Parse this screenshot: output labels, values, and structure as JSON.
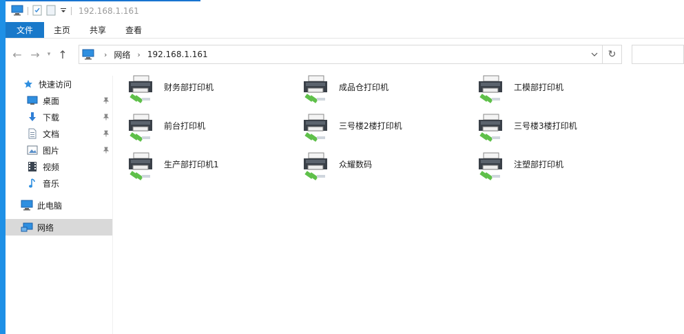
{
  "window": {
    "title": "192.168.1.161"
  },
  "ribbon": {
    "tabs": [
      {
        "label": "文件"
      },
      {
        "label": "主页"
      },
      {
        "label": "共享"
      },
      {
        "label": "查看"
      }
    ]
  },
  "address": {
    "crumbs": [
      "网络",
      "192.168.1.161"
    ]
  },
  "sidebar": {
    "quick_access": "快速访问",
    "items": [
      {
        "label": "桌面",
        "icon": "desktop-icon",
        "pinned": true
      },
      {
        "label": "下载",
        "icon": "download-icon",
        "pinned": true
      },
      {
        "label": "文档",
        "icon": "document-icon",
        "pinned": true
      },
      {
        "label": "图片",
        "icon": "picture-icon",
        "pinned": true
      },
      {
        "label": "视频",
        "icon": "video-icon",
        "pinned": false
      },
      {
        "label": "音乐",
        "icon": "music-icon",
        "pinned": false
      }
    ],
    "this_pc": "此电脑",
    "network": "网络"
  },
  "printers": [
    "财务部打印机",
    "成品仓打印机",
    "工模部打印机",
    "前台打印机",
    "三号楼2楼打印机",
    "三号楼3楼打印机",
    "生产部打印机1",
    "众耀数码",
    "注塑部打印机"
  ],
  "colors": {
    "accent": "#1979ca",
    "desktop": "#1e90e6",
    "selection": "#d9d9d9"
  }
}
